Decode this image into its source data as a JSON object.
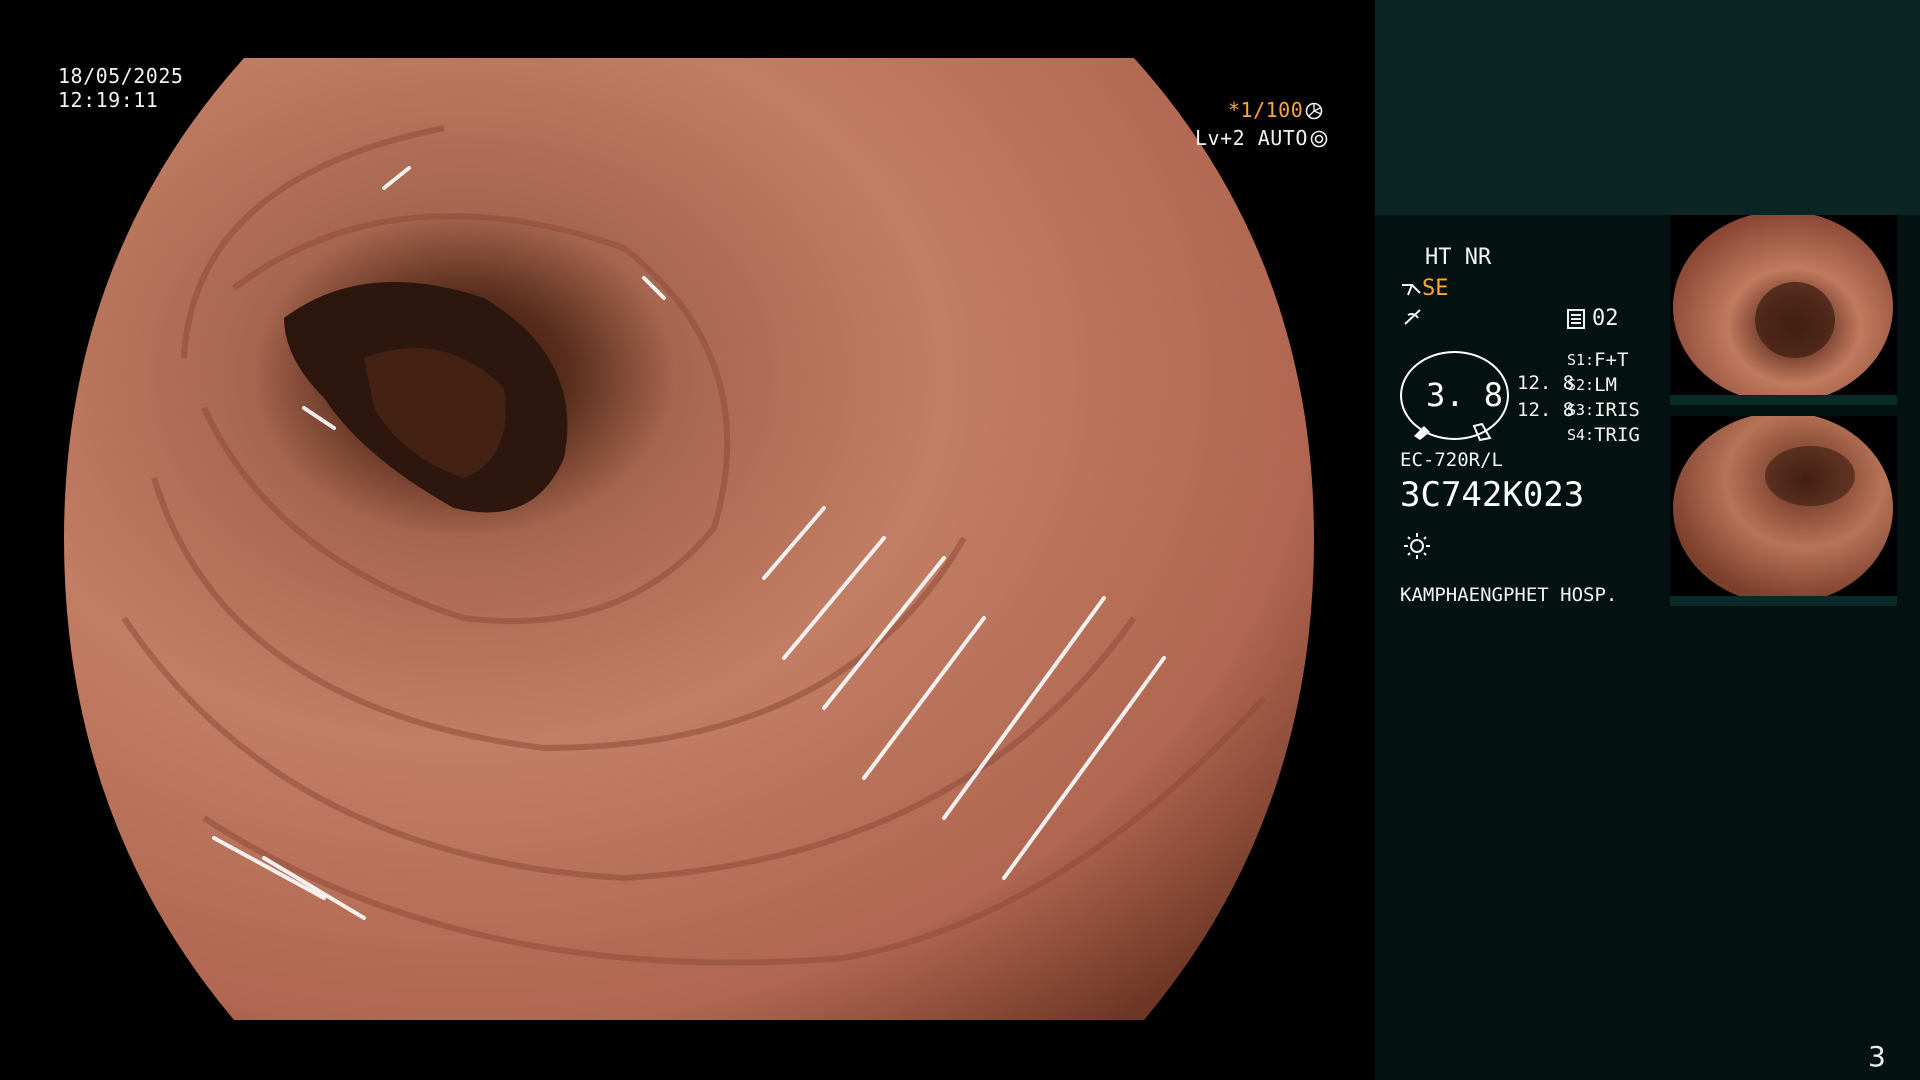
{
  "scope": {
    "date": "18/05/2025",
    "time": "12:19:11",
    "shutter": "*1/100",
    "shutter_icon": "aperture-icon",
    "level": "Lv+2 AUTO",
    "level_icon": "target-icon"
  },
  "panel": {
    "ht_nr": "HT NR",
    "se": "SE",
    "enhance_icon": "enhance-icon",
    "color_icon": "color-icon",
    "count_icon": "document-icon",
    "count": "02",
    "iris_value": "3. 8",
    "left_values": [
      "12. 8",
      "12. 8"
    ],
    "switches": [
      {
        "key": "S1:",
        "value": "F+T"
      },
      {
        "key": "S2:",
        "value": "LM"
      },
      {
        "key": "S3:",
        "value": "IRIS"
      },
      {
        "key": "S4:",
        "value": "TRIG"
      }
    ],
    "scope_model": "EC-720R/L",
    "serial": "3C742K023",
    "light_icon": "sun-icon",
    "hospital": "KAMPHAENGPHET HOSP."
  },
  "page_number": "3",
  "colors": {
    "background": "#000000",
    "panel": "#031210",
    "panel_top": "#0b2424",
    "accent": "#ffa733",
    "mucosa": "#b9735e"
  }
}
